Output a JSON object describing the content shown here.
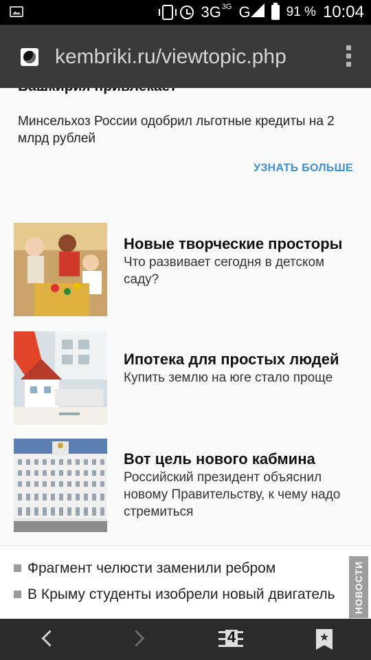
{
  "status_bar": {
    "network": "3G",
    "network_sup": "3G",
    "network2": "G",
    "battery": "91 %",
    "time": "10:04"
  },
  "browser": {
    "url": "kembriki.ru/viewtopic.php",
    "tab_count": "4"
  },
  "promo": {
    "cut_title": "Башкирия привлекает",
    "text": "Минсельхоз России одобрил льготные кредиты на 2 млрд рублей",
    "cta": "УЗНАТЬ БОЛЬШЕ"
  },
  "articles": [
    {
      "title": "Новые творческие просторы",
      "desc": "Что развивает сегодня в детском саду?"
    },
    {
      "title": "Ипотека для простых людей",
      "desc": "Купить землю на юге стало проще"
    },
    {
      "title": "Вот цель нового кабмина",
      "desc": "Российский президент объяснил новому Правительству, к чему надо стремиться"
    }
  ],
  "news": {
    "tab_label": "НОВОСТИ",
    "items": [
      {
        "text": "Фрагмент челюсти заменили ребром"
      },
      {
        "text": "В Крыму студенты изобрели новый двигатель"
      }
    ]
  },
  "colors": {
    "status_bar": "#000000",
    "url_bar": "#3a3a3a",
    "link_accent": "#3d8fd6",
    "bottom_nav": "#2b2b2b"
  }
}
